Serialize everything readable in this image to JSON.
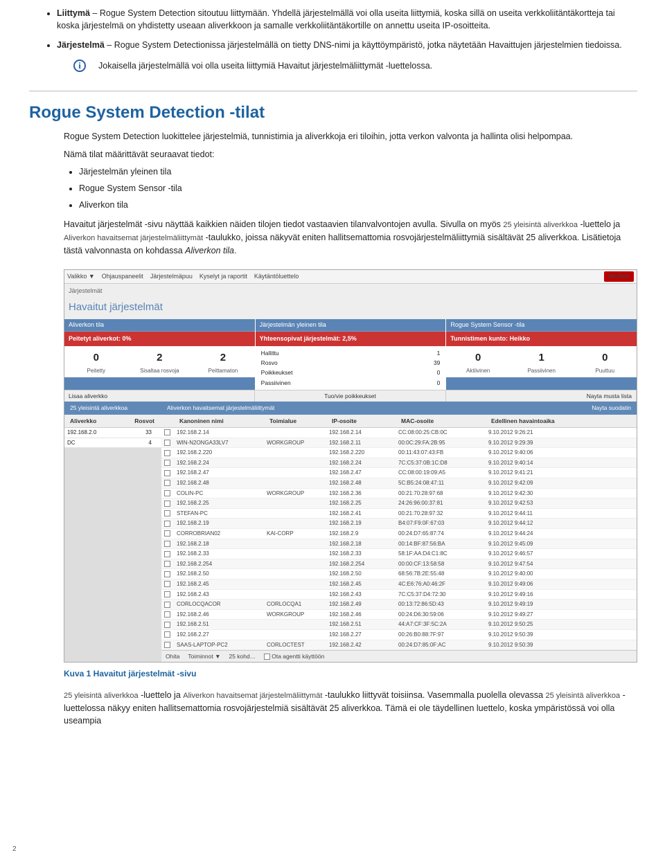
{
  "top_bullets": {
    "b1_bold": "Liittymä",
    "b1_text": " – Rogue System Detection sitoutuu liittymään. Yhdellä järjestelmällä voi olla useita liittymiä, koska sillä on useita verkkoliitäntäkortteja tai koska järjestelmä on yhdistetty useaan aliverkkoon ja samalle verkkoliitäntäkortille on annettu useita IP-osoitteita.",
    "b2_bold": "Järjestelmä",
    "b2_text": " – Rogue System Detectionissa järjestelmällä on tietty DNS-nimi ja käyttöympäristö, jotka näytetään Havaittujen järjestelmien tiedoissa."
  },
  "info_note": "Jokaisella järjestelmällä voi olla useita liittymiä Havaitut järjestelmäliittymät -luettelossa.",
  "section_title": "Rogue System Detection -tilat",
  "intro1": "Rogue System Detection luokittelee järjestelmiä, tunnistimia ja aliverkkoja eri tiloihin, jotta verkon valvonta ja hallinta olisi helpompaa.",
  "intro2": "Nämä tilat määrittävät seuraavat tiedot:",
  "state_bullets": [
    "Järjestelmän yleinen tila",
    "Rogue System Sensor -tila",
    "Aliverkon tila"
  ],
  "para2a": "Havaitut järjestelmät -sivu näyttää kaikkien näiden tilojen tiedot vastaavien tilanvalvontojen avulla. Sivulla on myös ",
  "para2b": "25 yleisintä aliverkkoa",
  "para2c": " -luettelo ja ",
  "para2d": "Aliverkon havaitsemat järjestelmäliittymät",
  "para2e": " -taulukko, joissa näkyvät eniten hallitsemattomia rosvojärjestelmäliittymiä sisältävät 25 aliverkkoa. Lisätietoja tästä valvonnasta on kohdassa ",
  "para2f": "Aliverkon tila",
  "screenshot": {
    "menu": [
      "Valikko ▼",
      "Ohjauspaneelit",
      "Järjestelmäpuu",
      "Kyselyt ja raportit",
      "Käytäntöluettelo"
    ],
    "brand": "McAfee",
    "crumb": "Järjestelmät",
    "title": "Havaitut järjestelmät",
    "panel1": {
      "head": "Aliverkon tila",
      "red": "Peitetyt aliverkot: 0%",
      "metrics": [
        {
          "n": "0",
          "l": "Peitetty"
        },
        {
          "n": "2",
          "l": "Sisaltaa rosvoja"
        },
        {
          "n": "2",
          "l": "Peittamaton"
        }
      ],
      "btn": "Lisaa aliverkko"
    },
    "panel2": {
      "head": "Järjestelmän yleinen tila",
      "red": "Yhteensopivat järjestelmät: 2,5%",
      "rows": [
        [
          "Hallittu",
          "1"
        ],
        [
          "Rosvo",
          "39"
        ],
        [
          "Poikkeukset",
          "0"
        ],
        [
          "Passiivinen",
          "0"
        ]
      ],
      "btn": "Tuo/vie poikkeukset"
    },
    "panel3": {
      "head": "Rogue System Sensor -tila",
      "red": "Tunnistimen kunto: Heikko",
      "metrics": [
        {
          "n": "0",
          "l": "Aktiivinen"
        },
        {
          "n": "1",
          "l": "Passiivinen"
        },
        {
          "n": "0",
          "l": "Puuttuu"
        }
      ],
      "btn": "Nayta musta lista"
    },
    "left_head": "25 yleisintä aliverkkoa",
    "right_head_text": "Aliverkon havaitsemat järjestelmäliittymät",
    "right_head_link": "Nayta suodatin",
    "left_cols": [
      "Aliverkko",
      "Rosvot"
    ],
    "left_rows": [
      [
        "192.168.2.0",
        "33"
      ],
      [
        "DC",
        "4"
      ]
    ],
    "right_cols": [
      "",
      "Kanoninen nimi",
      "Toimialue",
      "IP-osoite",
      "MAC-osoite",
      "Edellinen havaintoaika"
    ],
    "right_rows": [
      [
        "192.168.2.14",
        "",
        "192.168.2.14",
        "CC:08:00:25:CB:0C",
        "9.10.2012 9:26:21"
      ],
      [
        "WIN-N2ONGA33LV7",
        "WORKGROUP",
        "192.168.2.11",
        "00:0C:29:FA:2B:95",
        "9.10.2012 9:29:39"
      ],
      [
        "192.168.2.220",
        "",
        "192.168.2.220",
        "00:11:43:07:43:FB",
        "9.10.2012 9:40:06"
      ],
      [
        "192.168.2.24",
        "",
        "192.168.2.24",
        "7C:C5:37:0B:1C:D8",
        "9.10.2012 9:40:14"
      ],
      [
        "192.168.2.47",
        "",
        "192.168.2.47",
        "CC:08:00:19:09:A5",
        "9.10.2012 9:41:21"
      ],
      [
        "192.168.2.48",
        "",
        "192.168.2.48",
        "5C:B5:24:08:47:11",
        "9.10.2012 9:42:09"
      ],
      [
        "COLIN-PC",
        "WORKGROUP",
        "192.168.2.36",
        "00:21:70:28:97:68",
        "9.10.2012 9:42:30"
      ],
      [
        "192.168.2.25",
        "",
        "192.168.2.25",
        "24:26:96:00:37:81",
        "9.10.2012 9:42:53"
      ],
      [
        "STEFAN-PC",
        "",
        "192.168.2.41",
        "00:21:70:28:97:32",
        "9.10.2012 9:44:11"
      ],
      [
        "192.168.2.19",
        "",
        "192.168.2.19",
        "B4:07:F9:0F:67:03",
        "9.10.2012 9:44:12"
      ],
      [
        "CORROBRIAN02",
        "KAI-CORP",
        "192.168.2.9",
        "00:24:D7:65:87:74",
        "9.10.2012 9:44:24"
      ],
      [
        "192.168.2.18",
        "",
        "192.168.2.18",
        "00:14:BF:87:56:BA",
        "9.10.2012 9:45:09"
      ],
      [
        "192.168.2.33",
        "",
        "192.168.2.33",
        "58:1F:AA:D4:C1:8C",
        "9.10.2012 9:46:57"
      ],
      [
        "192.168.2.254",
        "",
        "192.168.2.254",
        "00:00:CF:13:58:58",
        "9.10.2012 9:47:54"
      ],
      [
        "192.168.2.50",
        "",
        "192.168.2.50",
        "68:56:7B:2E:55:48",
        "9.10.2012 9:40:00"
      ],
      [
        "192.168.2.45",
        "",
        "192.168.2.45",
        "4C:E6:76:A0:46:2F",
        "9.10.2012 9:49:06"
      ],
      [
        "192.168.2.43",
        "",
        "192.168.2.43",
        "7C:C5:37:D4:72:30",
        "9.10.2012 9:49:16"
      ],
      [
        "CORLOCQACOR",
        "CORLOCQA1",
        "192.168.2.49",
        "00:13:72:86:5D:43",
        "9.10.2012 9:49:19"
      ],
      [
        "192.168.2.46",
        "WORKGROUP",
        "192.168.2.46",
        "00:24:D6:30:59:06",
        "9.10.2012 9:49:27"
      ],
      [
        "192.168.2.51",
        "",
        "192.168.2.51",
        "44:A7:CF:3F:5C:2A",
        "9.10.2012 9:50:25"
      ],
      [
        "192.168.2.27",
        "",
        "192.168.2.27",
        "00:26:B0:88:7F:97",
        "9.10.2012 9:50:39"
      ],
      [
        "SAAS-LAPTOP-PC2",
        "CORLOCTEST",
        "192.168.2.42",
        "00:24:D7:85:0F:AC",
        "9.10.2012 9:50:39"
      ]
    ],
    "footer": [
      "Ohita",
      "Toiminnot ▼",
      "25 kohd…",
      "Ota agentti käyttöön"
    ]
  },
  "figcap": "Kuva 1  Havaitut järjestelmät -sivu",
  "final_a": "25 yleisintä aliverkkoa",
  "final_b": " -luettelo ja ",
  "final_c": "Aliverkon havaitsemat järjestelmäliittymät",
  "final_d": " -taulukko liittyvät toisiinsa. Vasemmalla puolella olevassa ",
  "final_e": "25 yleisintä aliverkkoa",
  "final_f": " -luettelossa näkyy eniten hallitsemattomia rosvojärjestelmiä sisältävät 25 aliverkkoa. Tämä ei ole täydellinen luettelo, koska ympäristössä voi olla useampia",
  "pagenum": "2"
}
